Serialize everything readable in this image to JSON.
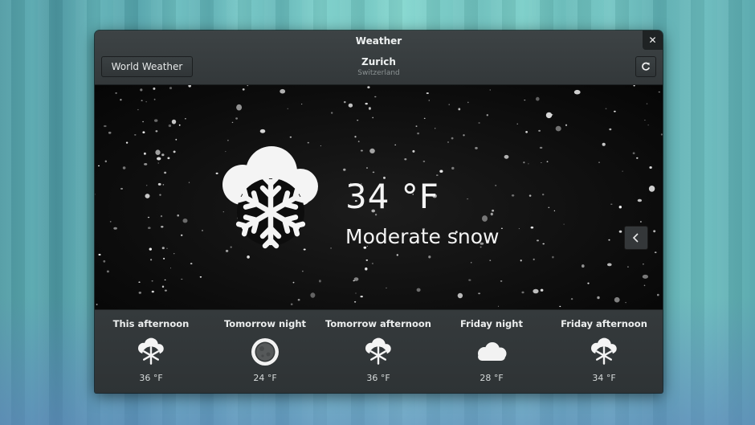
{
  "window": {
    "title": "Weather",
    "close_glyph": "✕"
  },
  "header": {
    "world_button_label": "World Weather",
    "city": "Zurich",
    "country": "Switzerland",
    "refresh_icon": "refresh-icon"
  },
  "current": {
    "temperature": "34 °F",
    "condition": "Moderate snow",
    "icon": "snow-icon"
  },
  "side_button_icon": "chevron-left-icon",
  "forecast": [
    {
      "label": "This afternoon",
      "temp": "36 °F",
      "icon": "snow-icon"
    },
    {
      "label": "Tomorrow night",
      "temp": "24 °F",
      "icon": "clear-night-icon"
    },
    {
      "label": "Tomorrow afternoon",
      "temp": "36 °F",
      "icon": "snow-icon"
    },
    {
      "label": "Friday night",
      "temp": "28 °F",
      "icon": "cloud-icon"
    },
    {
      "label": "Friday afternoon",
      "temp": "34 °F",
      "icon": "snow-icon"
    }
  ],
  "colors": {
    "window_bg": "#2c3133",
    "hero_bg": "#0c0c0c",
    "text": "#eef1f1"
  }
}
